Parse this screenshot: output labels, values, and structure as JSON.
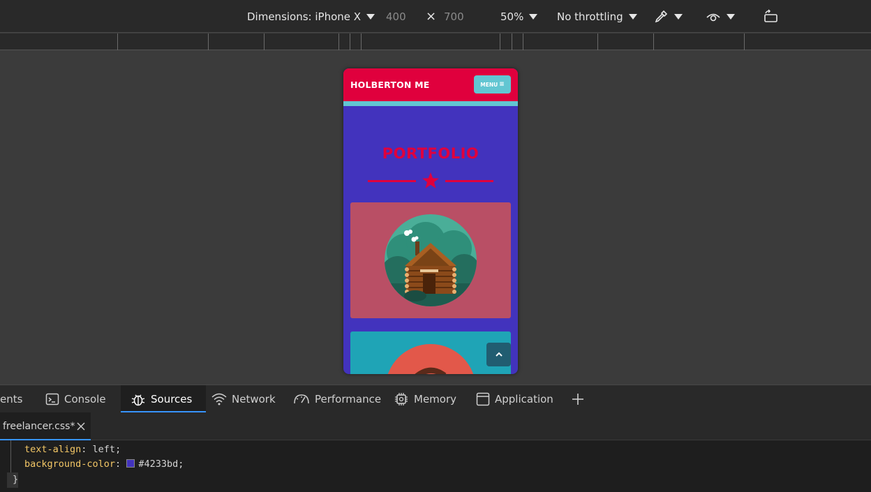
{
  "device_toolbar": {
    "dimensions_label": "Dimensions: iPhone X",
    "width": "400",
    "times": "×",
    "height": "700",
    "zoom": "50%",
    "throttling": "No throttling"
  },
  "preview": {
    "brand": "HOLBERTON ME",
    "menu_label": "MENU",
    "menu_icon": "≡",
    "section_title": "PORTFOLIO",
    "colors": {
      "nav": "#e0003d",
      "nav_underline": "#62c6d2",
      "page_bg": "#4233bd",
      "card_1": "#b94f65",
      "card_2": "#1fa4b6"
    },
    "cards": [
      {
        "icon": "log-cabin-icon"
      },
      {
        "icon": "cake-icon"
      }
    ]
  },
  "devtools_tabs": [
    {
      "label": "ents",
      "icon": ""
    },
    {
      "label": "Console",
      "icon": "console-icon"
    },
    {
      "label": "Sources",
      "icon": "bug-icon",
      "active": true
    },
    {
      "label": "Network",
      "icon": "wifi-icon"
    },
    {
      "label": "Performance",
      "icon": "gauge-icon"
    },
    {
      "label": "Memory",
      "icon": "chip-icon"
    },
    {
      "label": "Application",
      "icon": "window-icon"
    },
    {
      "label": "+",
      "icon": "plus-icon"
    }
  ],
  "file_tab": {
    "name": "freelancer.css*"
  },
  "code": {
    "line1_prop": "text-align",
    "line1_val": "left",
    "line2_prop": "background-color",
    "line2_val": "#4233bd",
    "brace": "}",
    "swatch_color": "#4233bd"
  }
}
